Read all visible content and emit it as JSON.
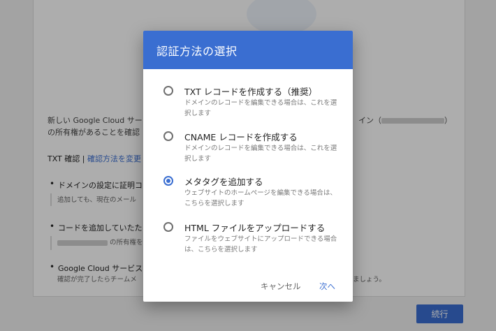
{
  "background": {
    "intro_line1": "新しい Google Cloud サー",
    "intro_line1_right": "イン（",
    "intro_line1_right_end": "）",
    "intro_line2": "の所有権があることを確認",
    "verify_label": "TXT 確認 |",
    "change_method_link": "確認方法を変更",
    "step1_title": "ドメインの設定に証明コ",
    "step1_desc": "追加しても、現在のメール",
    "step2_title": "コードを追加していたた",
    "step2_desc": "の所有権を",
    "step3_title": "Google Cloud サービスの",
    "step3_desc": "確認が完了したらチームメ",
    "step3_desc_right": "ましょう。",
    "continue_button": "続行"
  },
  "dialog": {
    "title": "認証方法の選択",
    "options": [
      {
        "label": "TXT レコードを作成する（推奨）",
        "description": "ドメインのレコードを編集できる場合は、これを選択します",
        "selected": false
      },
      {
        "label": "CNAME レコードを作成する",
        "description": "ドメインのレコードを編集できる場合は、これを選択します",
        "selected": false
      },
      {
        "label": "メタタグを追加する",
        "description": "ウェブサイトのホームページを編集できる場合は、こちらを選択します",
        "selected": true
      },
      {
        "label": "HTML ファイルをアップロードする",
        "description": "ファイルをウェブサイトにアップロードできる場合は、こちらを選択します",
        "selected": false
      }
    ],
    "cancel_button": "キャンセル",
    "next_button": "次へ"
  },
  "colors": {
    "accent": "#3a6ed1",
    "scrim": "rgba(0,0,0,0.32)"
  }
}
